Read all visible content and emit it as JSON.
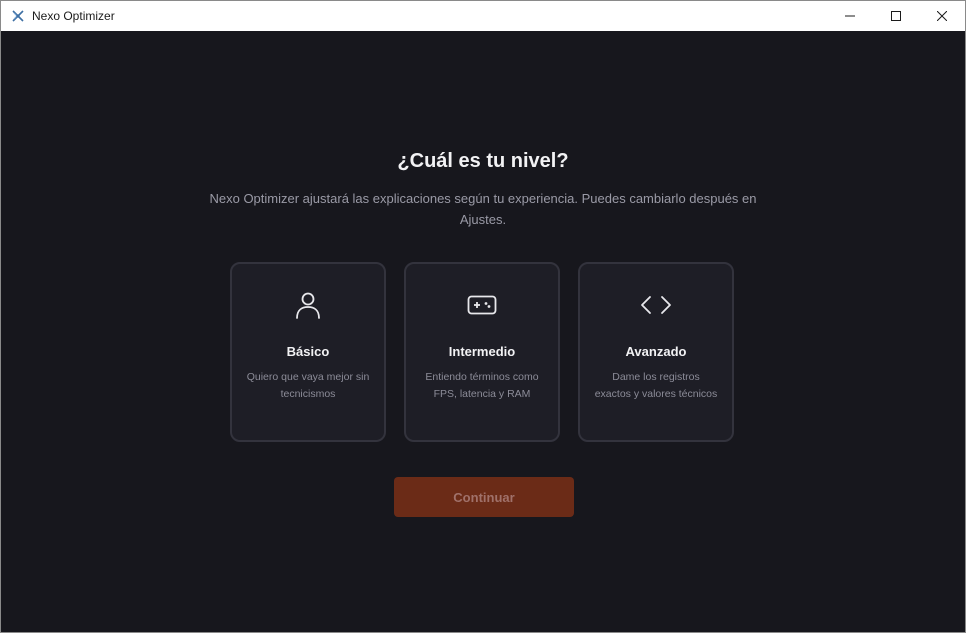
{
  "window": {
    "title": "Nexo Optimizer"
  },
  "main": {
    "heading": "¿Cuál es tu nivel?",
    "subtitle": "Nexo Optimizer ajustará las explicaciones según tu experiencia. Puedes cambiarlo después en Ajustes.",
    "cards": [
      {
        "name": "Básico",
        "desc": "Quiero que vaya mejor sin tecnicismos",
        "icon": "user-icon"
      },
      {
        "name": "Intermedio",
        "desc": "Entiendo términos como FPS, latencia y RAM",
        "icon": "gamepad-icon"
      },
      {
        "name": "Avanzado",
        "desc": "Dame los registros exactos y valores técnicos",
        "icon": "code-icon"
      }
    ],
    "continue_label": "Continuar"
  },
  "colors": {
    "background": "#17171d",
    "card": "#1e1e26",
    "card_border": "#33333d",
    "accent_disabled": "#6b2b17"
  }
}
